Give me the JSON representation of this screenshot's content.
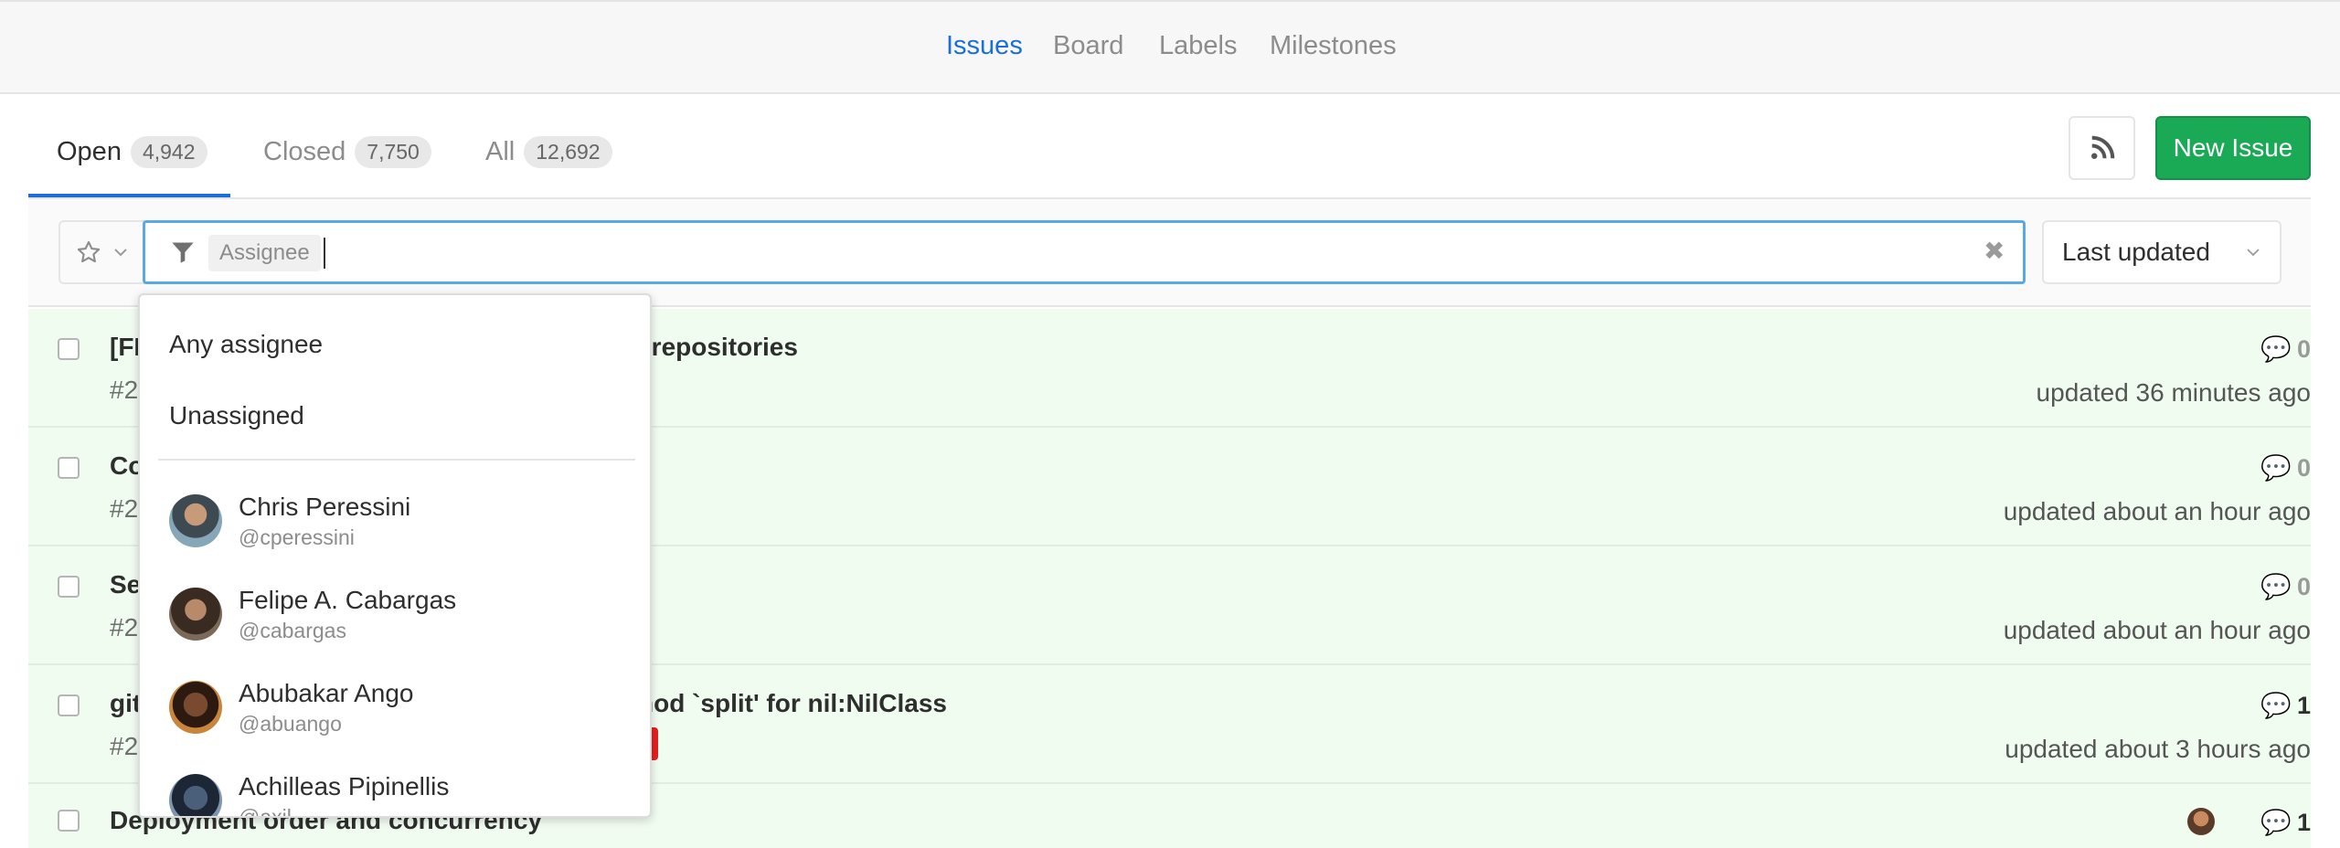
{
  "nav": {
    "links": [
      "Issues",
      "Board",
      "Labels",
      "Milestones"
    ],
    "active": "Issues"
  },
  "tabs": [
    {
      "label": "Open",
      "count": "4,942"
    },
    {
      "label": "Closed",
      "count": "7,750"
    },
    {
      "label": "All",
      "count": "12,692"
    }
  ],
  "actions": {
    "new_issue": "New Issue",
    "rss_icon": "rss-icon"
  },
  "filter": {
    "token": "Assignee",
    "sort_label": "Last updated"
  },
  "dropdown": {
    "options": [
      "Any assignee",
      "Unassigned"
    ],
    "users": [
      {
        "name": "Chris Peressini",
        "handle": "@cperessini"
      },
      {
        "name": "Felipe A. Cabargas",
        "handle": "@cabargas"
      },
      {
        "name": "Abubakar Ango",
        "handle": "@abuango"
      },
      {
        "name": "Achilleas Pipinellis",
        "handle": "@axil"
      }
    ]
  },
  "issues": [
    {
      "title_left": "[FI",
      "title_right": "r repositories",
      "ref": "#2",
      "comments": "0",
      "updated": "updated 36 minutes ago"
    },
    {
      "title_left": "Co",
      "title_right": "",
      "ref": "#2",
      "comments": "0",
      "updated": "updated about an hour ago"
    },
    {
      "title_left": "Se",
      "title_right": "",
      "ref": "#2",
      "comments": "0",
      "updated": "updated about an hour ago"
    },
    {
      "title_left": "git",
      "title_right": "hod `split' for nil:NilClass",
      "ref": "#2",
      "comments": "1",
      "updated": "updated about 3 hours ago"
    },
    {
      "title_left": "Deployment order and concurrency",
      "title_right": "",
      "ref": "",
      "comments": "1",
      "updated": ""
    }
  ],
  "colors": {
    "accent": "#1b6fd8",
    "new_issue": "#1aaa55",
    "row_bg": "#f1fcf1"
  }
}
